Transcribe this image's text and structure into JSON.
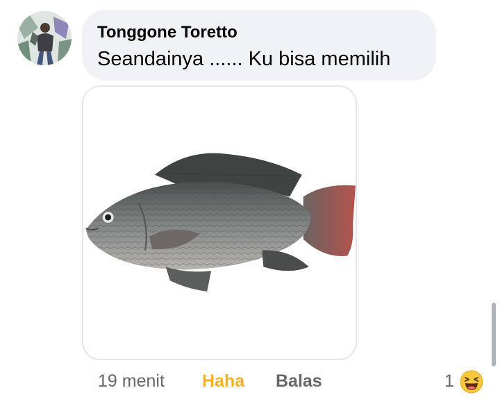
{
  "comment": {
    "author": "Tonggone Toretto",
    "text": "Seandainya ...... Ku bisa memilih",
    "avatar_icon": "profile-photo",
    "attachment_icon": "tilapia-fish-photo"
  },
  "actions": {
    "time": "19 menit",
    "reaction_label": "Haha",
    "reaction_color": "#f7b125",
    "reply_label": "Balas"
  },
  "reactions": {
    "count": "1",
    "icon": "laughing-emoji"
  }
}
